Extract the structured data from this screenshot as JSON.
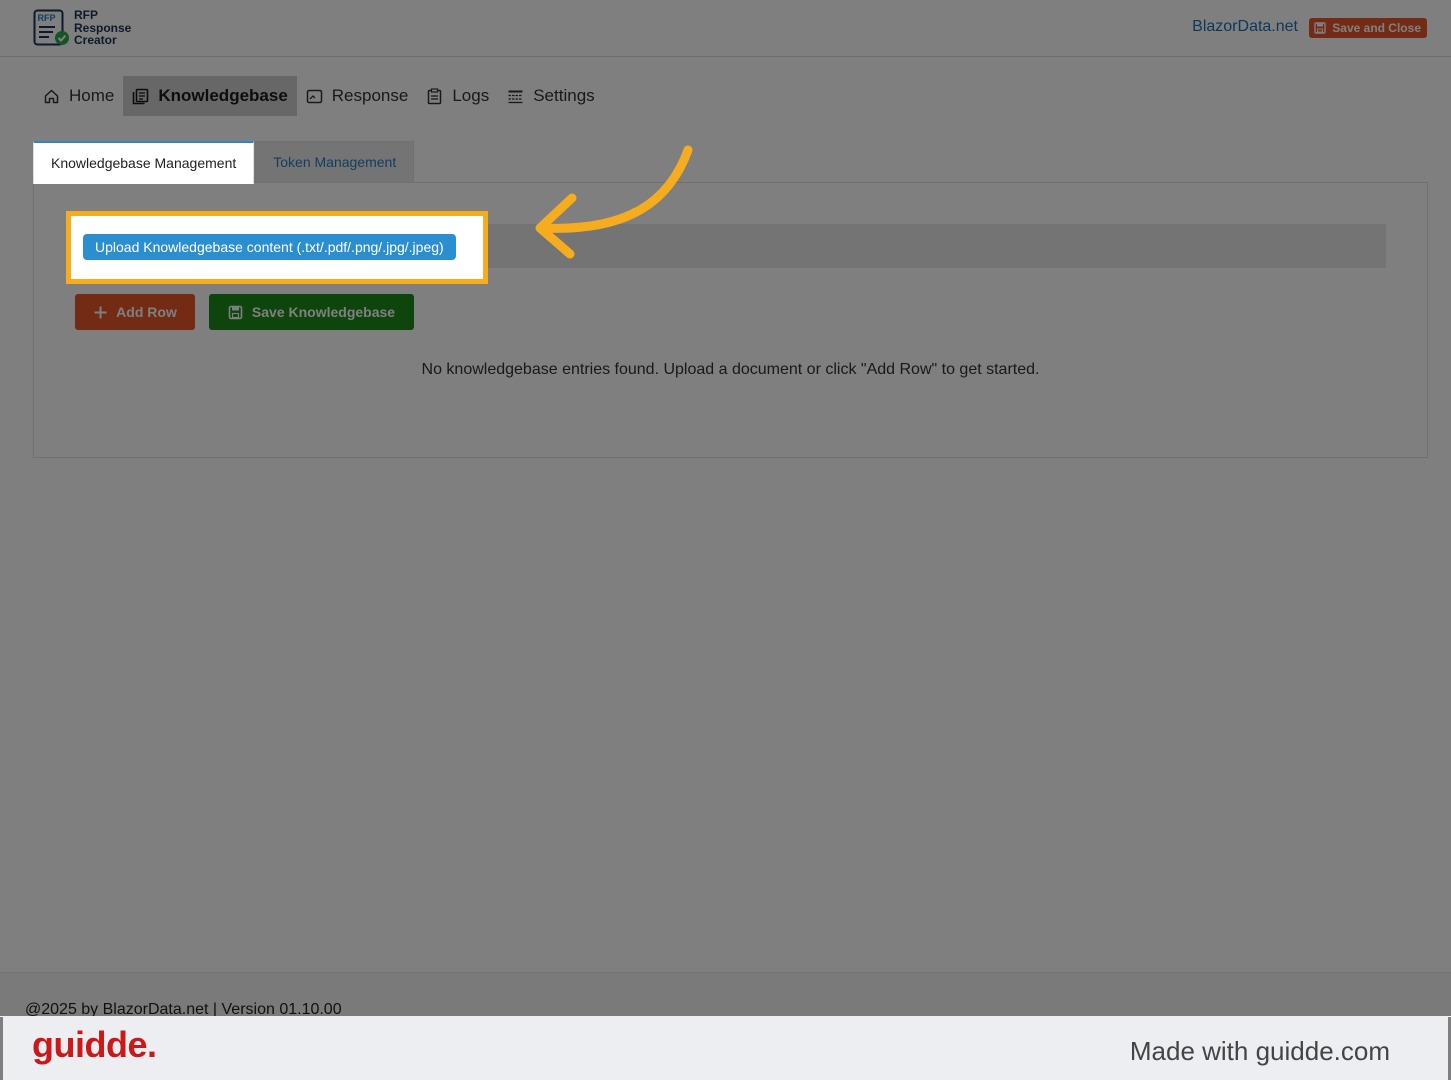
{
  "header": {
    "logo_lines": [
      "RFP",
      "Response",
      "Creator"
    ],
    "logo_badge": "RFP",
    "brand_link": "BlazorData.net",
    "save_close_label": "Save and Close"
  },
  "nav": {
    "items": [
      {
        "label": "Home",
        "icon": "home-icon",
        "active": false
      },
      {
        "label": "Knowledgebase",
        "icon": "knowledgebase-icon",
        "active": true
      },
      {
        "label": "Response",
        "icon": "response-icon",
        "active": false
      },
      {
        "label": "Logs",
        "icon": "logs-icon",
        "active": false
      },
      {
        "label": "Settings",
        "icon": "settings-icon",
        "active": false
      }
    ]
  },
  "tabs": [
    {
      "label": "Knowledgebase Management",
      "active": true
    },
    {
      "label": "Token Management",
      "active": false
    }
  ],
  "main": {
    "upload_label": "Upload Knowledgebase content (.txt/.pdf/.png/.jpg/.jpeg)",
    "add_row_label": "Add Row",
    "save_kb_label": "Save Knowledgebase",
    "empty_message": "No knowledgebase entries found. Upload a document or click \"Add Row\" to get started."
  },
  "footer": {
    "text": "@2025 by BlazorData.net | Version 01.10.00"
  },
  "guidde": {
    "logo": "guidde.",
    "credit": "Made with guidde.com"
  },
  "colors": {
    "accent_blue": "#2b8fcf",
    "orange": "#e8572b",
    "green": "#1a8a1a",
    "highlight": "#f6ac1f",
    "guidde_red": "#cc1818"
  }
}
